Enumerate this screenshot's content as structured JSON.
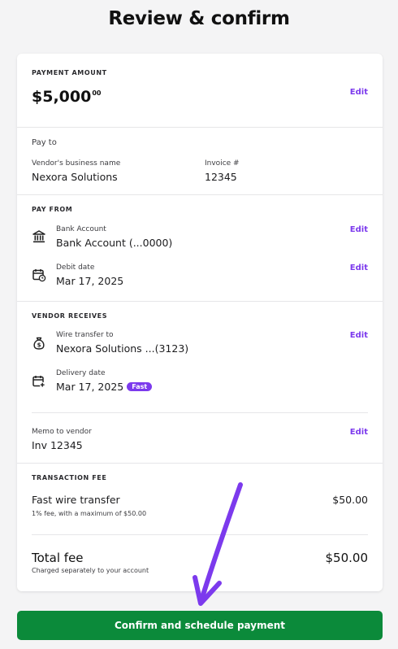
{
  "page": {
    "title": "Review & confirm"
  },
  "payment_amount": {
    "caption": "PAYMENT AMOUNT",
    "amount_main": "$5,000",
    "amount_cents": "00",
    "edit_label": "Edit"
  },
  "pay_to": {
    "heading": "Pay to",
    "vendor_label": "Vendor's business name",
    "vendor_value": "Nexora Solutions",
    "invoice_label": "Invoice #",
    "invoice_value": "12345"
  },
  "pay_from": {
    "caption": "PAY FROM",
    "bank_label": "Bank Account",
    "bank_value": "Bank Account (...0000)",
    "bank_edit": "Edit",
    "debit_label": "Debit date",
    "debit_value": "Mar 17, 2025",
    "debit_edit": "Edit"
  },
  "vendor_receives": {
    "caption": "VENDOR RECEIVES",
    "wire_label": "Wire transfer to",
    "wire_value": "Nexora Solutions ...(3123)",
    "wire_edit": "Edit",
    "delivery_label": "Delivery date",
    "delivery_value": "Mar 17, 2025",
    "delivery_badge": "Fast",
    "memo_label": "Memo to vendor",
    "memo_value": "Inv 12345",
    "memo_edit": "Edit"
  },
  "transaction_fee": {
    "caption": "TRANSACTION FEE",
    "fee_name": "Fast wire transfer",
    "fee_value": "$50.00",
    "fee_note": "1% fee, with a maximum of $50.00",
    "total_label": "Total fee",
    "total_value": "$50.00",
    "total_note": "Charged separately to your account"
  },
  "actions": {
    "confirm_label": "Confirm and schedule payment"
  },
  "colors": {
    "accent": "#7c3aed",
    "confirm": "#0b8a3a",
    "annotation_arrow": "#7c3aed"
  },
  "icons": [
    "bank-icon",
    "calendar-clock-icon",
    "money-bag-icon",
    "calendar-plus-icon"
  ]
}
